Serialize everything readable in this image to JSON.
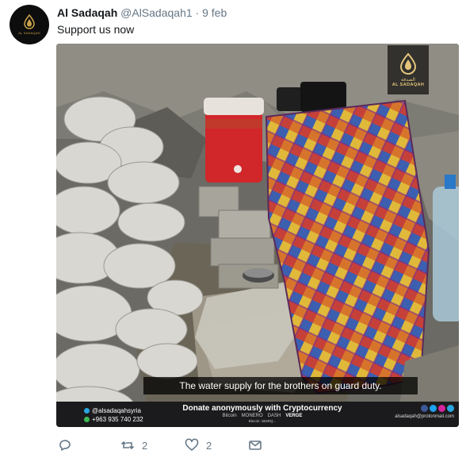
{
  "tweet": {
    "author_name": "Al Sadaqah",
    "handle": "@AlSadaqah1",
    "separator": "·",
    "date": "9 feb",
    "text": "Support us now",
    "avatar_text": "AL SADAQAH"
  },
  "media": {
    "caption": "The water supply for the brothers on guard duty.",
    "watermark_arabic": "الصدقة",
    "watermark_latin": "AL SADAQAH",
    "footer": {
      "telegram": "@alsadaqahsyria",
      "phone": "+963 935 740 232",
      "donate": "Donate anonymously with Cryptocurrency",
      "cryptos": [
        "Bitcoin",
        "MONERO",
        "DASH",
        "VERGE"
      ],
      "small_text": "Bitcoin: 1B4RQ...",
      "email": "alsadaqah@protonmail.com"
    }
  },
  "actions": {
    "reply_count": "",
    "retweet_count": "2",
    "like_count": "2"
  },
  "colors": {
    "gold": "#c9a14a",
    "text_secondary": "#657786",
    "footer_bg": "#1b1b1d"
  }
}
